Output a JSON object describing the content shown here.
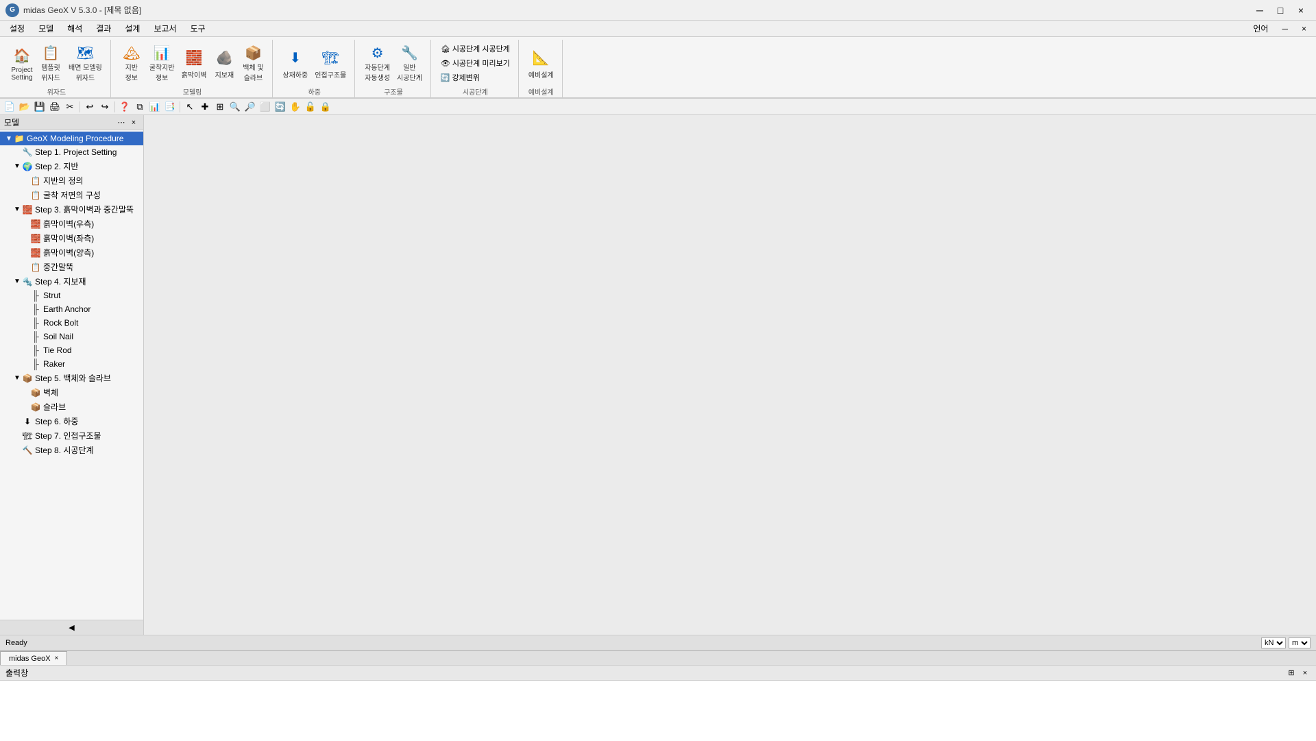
{
  "app": {
    "title": "midas GeoX V 5.3.0 - [제목 없음]",
    "icon_label": "G",
    "status": "Ready",
    "units": [
      "kN",
      "m"
    ]
  },
  "title_bar": {
    "minimize": "─",
    "restore": "□",
    "close": "×",
    "menu_icon": "≡"
  },
  "menu": {
    "items": [
      "설정",
      "모델",
      "해석",
      "결과",
      "설계",
      "보고서",
      "도구",
      "언어"
    ]
  },
  "quick_access": {
    "tools": [
      "📄",
      "💾",
      "🖨",
      "✂",
      "📋",
      "↩",
      "↪",
      "❓",
      "⧉",
      "📊",
      "📑"
    ]
  },
  "ribbon": {
    "groups": [
      {
        "label": "위자드",
        "buttons": [
          {
            "icon": "🏠",
            "label": "Project\nSetting"
          },
          {
            "icon": "📋",
            "label": "템플릿\n위자드"
          },
          {
            "icon": "🗺",
            "label": "배면 모델링\n위자드"
          }
        ]
      },
      {
        "label": "모델링",
        "buttons": [
          {
            "icon": "🏔",
            "label": "지반\n정보"
          },
          {
            "icon": "📊",
            "label": "굴착지반\n정보"
          },
          {
            "icon": "🧱",
            "label": "흙막이벽"
          },
          {
            "icon": "🪨",
            "label": "지보재"
          },
          {
            "icon": "📦",
            "label": "백체 및\n슬라브"
          }
        ]
      },
      {
        "label": "하중",
        "buttons": [
          {
            "icon": "⬇",
            "label": "상재하중"
          },
          {
            "icon": "🏗",
            "label": "인접구조물"
          }
        ]
      },
      {
        "label": "구조물",
        "buttons": [
          {
            "icon": "⬇",
            "label": "일반\n시공단계"
          }
        ]
      },
      {
        "label": "시공단계",
        "buttons": [
          {
            "icon": "🏚",
            "label": "시공단계 시공단계",
            "wide": true
          },
          {
            "icon": "👁",
            "label": "시공단계 미리보기",
            "wide": true
          },
          {
            "icon": "🔄",
            "label": "강제변위",
            "wide": true
          }
        ]
      },
      {
        "label": "예비설계",
        "buttons": [
          {
            "icon": "📐",
            "label": "예비설계"
          }
        ]
      }
    ]
  },
  "panel": {
    "title": "모델",
    "tree": [
      {
        "id": "geox-procedure",
        "label": "GeoX Modeling Procedure",
        "level": 0,
        "expanded": true,
        "has_toggle": true,
        "highlighted": true,
        "icon": "📁"
      },
      {
        "id": "step1",
        "label": "Step 1. Project Setting",
        "level": 1,
        "expanded": false,
        "has_toggle": false,
        "icon": "🔧"
      },
      {
        "id": "step2",
        "label": "Step 2. 지반",
        "level": 1,
        "expanded": true,
        "has_toggle": true,
        "icon": "🌍"
      },
      {
        "id": "step2-ground-def",
        "label": "지반의 정의",
        "level": 2,
        "expanded": false,
        "has_toggle": false,
        "icon": "📋"
      },
      {
        "id": "step2-cross",
        "label": "굴착 저면의 구성",
        "level": 2,
        "expanded": false,
        "has_toggle": false,
        "icon": "📋"
      },
      {
        "id": "step3",
        "label": "Step 3. 흙막이벽과 중간말뚝",
        "level": 1,
        "expanded": true,
        "has_toggle": true,
        "icon": "🧱"
      },
      {
        "id": "step3-wall-right",
        "label": "흙막이벽(우측)",
        "level": 2,
        "expanded": false,
        "has_toggle": false,
        "icon": "🧱"
      },
      {
        "id": "step3-wall-left1",
        "label": "흙막이벽(좌측)",
        "level": 2,
        "expanded": false,
        "has_toggle": false,
        "icon": "🧱"
      },
      {
        "id": "step3-wall-both",
        "label": "흙막이벽(양측)",
        "level": 2,
        "expanded": false,
        "has_toggle": false,
        "icon": "🧱"
      },
      {
        "id": "step3-pile",
        "label": "중간말뚝",
        "level": 2,
        "expanded": false,
        "has_toggle": false,
        "icon": "📋"
      },
      {
        "id": "step4",
        "label": "Step 4. 지보재",
        "level": 1,
        "expanded": true,
        "has_toggle": true,
        "icon": "🔩"
      },
      {
        "id": "step4-strut",
        "label": "Strut",
        "level": 2,
        "expanded": false,
        "has_toggle": false,
        "icon": "─"
      },
      {
        "id": "step4-earth-anchor",
        "label": "Earth Anchor",
        "level": 2,
        "expanded": false,
        "has_toggle": false,
        "icon": "─"
      },
      {
        "id": "step4-rock-bolt",
        "label": "Rock Bolt",
        "level": 2,
        "expanded": false,
        "has_toggle": false,
        "icon": "─"
      },
      {
        "id": "step4-soil-nail",
        "label": "Soil Nail",
        "level": 2,
        "expanded": false,
        "has_toggle": false,
        "icon": "─"
      },
      {
        "id": "step4-tie-rod",
        "label": "Tie Rod",
        "level": 2,
        "expanded": false,
        "has_toggle": false,
        "icon": "─"
      },
      {
        "id": "step4-raker",
        "label": "Raker",
        "level": 2,
        "expanded": false,
        "has_toggle": false,
        "icon": "╱"
      },
      {
        "id": "step5",
        "label": "Step 5. 백체와 슬라브",
        "level": 1,
        "expanded": true,
        "has_toggle": true,
        "icon": "📦"
      },
      {
        "id": "step5-wall",
        "label": "벽체",
        "level": 2,
        "expanded": false,
        "has_toggle": false,
        "icon": "📦"
      },
      {
        "id": "step5-slab",
        "label": "슬라브",
        "level": 2,
        "expanded": false,
        "has_toggle": false,
        "icon": "📦"
      },
      {
        "id": "step6",
        "label": "Step 6. 하중",
        "level": 1,
        "expanded": false,
        "has_toggle": false,
        "icon": "⬇"
      },
      {
        "id": "step7",
        "label": "Step 7. 인접구조물",
        "level": 1,
        "expanded": false,
        "has_toggle": false,
        "icon": "🏗"
      },
      {
        "id": "step8",
        "label": "Step 8. 시공단계",
        "level": 1,
        "expanded": false,
        "has_toggle": false,
        "icon": "🔨"
      }
    ]
  },
  "tabs": [
    {
      "label": "midas GeoX",
      "active": true
    }
  ],
  "output": {
    "title": "출력창",
    "content": ""
  },
  "statusbar": {
    "status": "Ready",
    "unit_force": "kN",
    "unit_length": "m"
  }
}
